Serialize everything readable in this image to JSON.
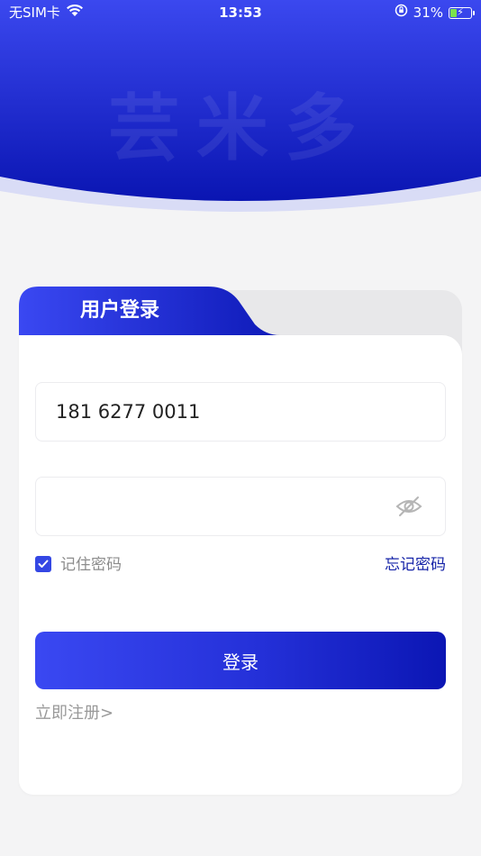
{
  "status_bar": {
    "carrier": "无SIM卡",
    "time": "13:53",
    "battery_percent": "31%",
    "battery_level": 0.31
  },
  "brand": {
    "watermark": "芸米多"
  },
  "login": {
    "tab_label": "用户登录",
    "phone_value": "181 6277 0011",
    "password_value": "",
    "remember_label": "记住密码",
    "remember_checked": true,
    "forgot_label": "忘记密码",
    "login_button": "登录",
    "register_link": "立即注册>"
  },
  "colors": {
    "primary": "#3447e4",
    "primary_dark": "#0b16b4",
    "link": "#1624a8",
    "background": "#f4f4f5"
  },
  "icons": {
    "wifi": "wifi-icon",
    "orientation_lock": "orientation-lock-icon",
    "battery": "battery-charging-icon",
    "password_visibility": "eye-off-icon",
    "checkbox": "checkmark-icon"
  }
}
